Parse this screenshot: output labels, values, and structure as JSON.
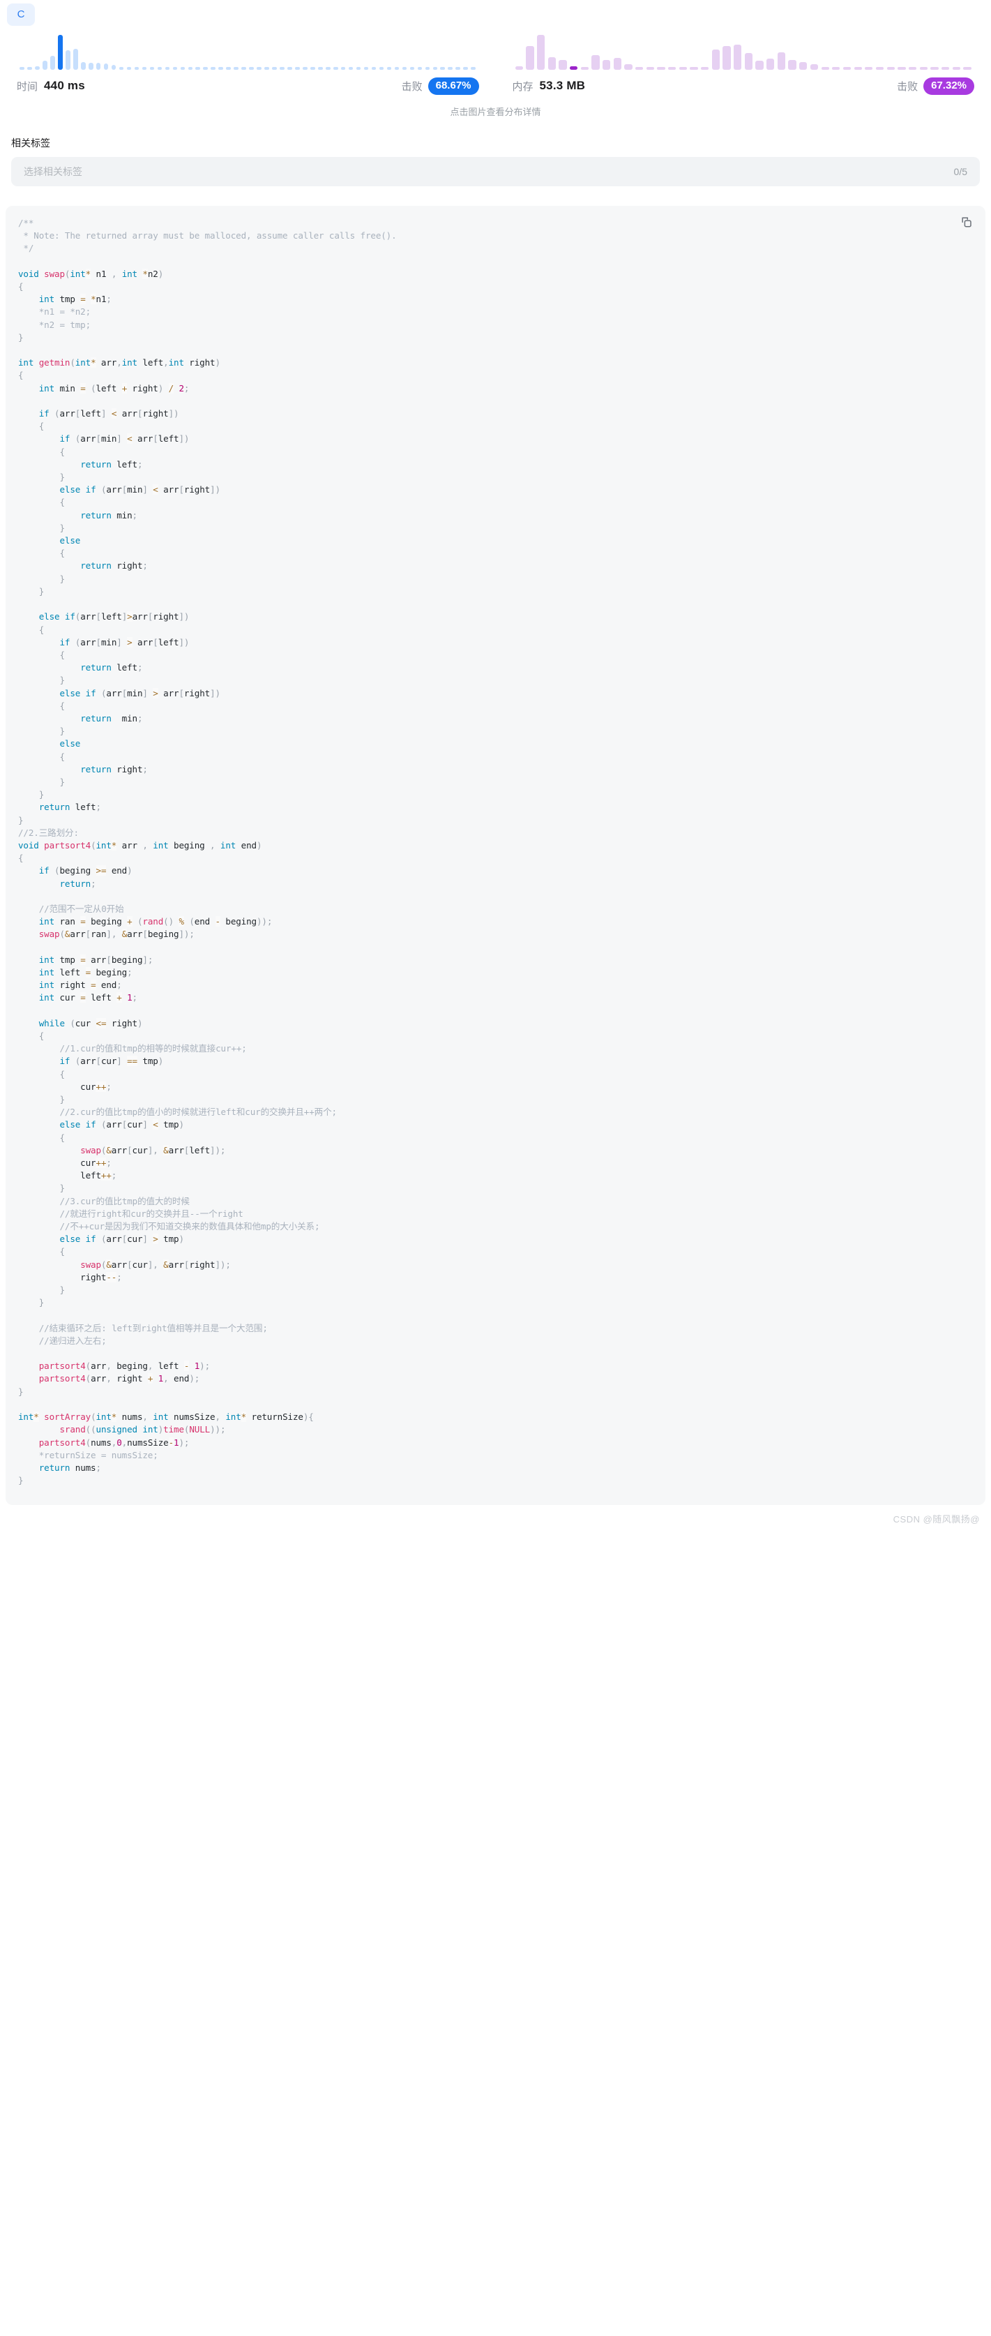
{
  "language_badge": "C",
  "stats": {
    "time": {
      "label": "时间",
      "value": "440 ms",
      "beat_label": "击败",
      "beat_value": "68.67%",
      "color": "#1575f0"
    },
    "memory": {
      "label": "内存",
      "value": "53.3 MB",
      "beat_label": "击败",
      "beat_value": "67.32%",
      "color": "#a83ae0"
    },
    "hint": "点击图片查看分布详情"
  },
  "chart_data": [
    {
      "type": "bar",
      "title": "时间分布",
      "xlabel": "",
      "ylabel": "",
      "highlight_index": 5,
      "highlight_color": "#1575f0",
      "bar_color": "#c7dffd",
      "values": [
        2,
        2,
        5,
        12,
        18,
        46,
        26,
        28,
        10,
        9,
        9,
        8,
        6,
        3,
        2,
        2,
        2,
        2,
        2,
        2,
        2,
        2,
        2,
        2,
        2,
        2,
        2,
        2,
        2,
        2,
        2,
        2,
        2,
        2,
        2,
        2,
        2,
        2,
        2,
        2,
        2,
        2,
        2,
        2,
        2,
        2,
        2,
        2,
        2,
        2,
        2,
        2,
        2,
        2,
        2,
        2,
        2,
        2,
        2,
        2
      ]
    },
    {
      "type": "bar",
      "title": "内存分布",
      "xlabel": "",
      "ylabel": "",
      "highlight_index": 5,
      "highlight_color": "#9b24c9",
      "bar_color": "#e6d0f2",
      "values": [
        4,
        26,
        38,
        14,
        11,
        4,
        2,
        16,
        11,
        13,
        6,
        3,
        2,
        2,
        2,
        2,
        2,
        2,
        22,
        26,
        27,
        18,
        10,
        12,
        19,
        11,
        8,
        6,
        3,
        2,
        2,
        2,
        2,
        2,
        2,
        2,
        2,
        2,
        2,
        2,
        2,
        2
      ]
    }
  ],
  "tags": {
    "title": "相关标签",
    "placeholder": "选择相关标签",
    "count": "0/5"
  },
  "code": {
    "copy_icon": "copy-icon",
    "language": "C",
    "lines": "/**\n * Note: The returned array must be malloced, assume caller calls free().\n */\n\nvoid swap(int* n1 , int *n2)\n{\n    int tmp = *n1;\n    *n1 = *n2;\n    *n2 = tmp;\n}\n\nint getmin(int* arr,int left,int right)\n{\n    int min = (left + right) / 2;\n\n    if (arr[left] < arr[right])\n    {\n        if (arr[min] < arr[left])\n        {\n            return left;\n        }\n        else if (arr[min] < arr[right])\n        {\n            return min;\n        }\n        else\n        {\n            return right;\n        }\n    }\n\n    else if(arr[left]>arr[right])\n    {\n        if (arr[min] > arr[left])\n        {\n            return left;\n        }\n        else if (arr[min] > arr[right])\n        {\n            return  min;\n        }\n        else\n        {\n            return right;\n        }\n    }\n    return left;\n}\n//2.三路划分:\nvoid partsort4(int* arr , int beging , int end)\n{\n    if (beging >= end)\n        return;\n\n    //范围不一定从0开始\n    int ran = beging + (rand() % (end - beging));\n    swap(&arr[ran], &arr[beging]);\n\n    int tmp = arr[beging];\n    int left = beging;\n    int right = end;\n    int cur = left + 1;\n\n    while (cur <= right)\n    {\n        //1.cur的值和tmp的相等的时候就直接cur++;\n        if (arr[cur] == tmp)\n        {\n            cur++;\n        }\n        //2.cur的值比tmp的值小的时候就进行left和cur的交换并且++两个;\n        else if (arr[cur] < tmp)\n        {\n            swap(&arr[cur], &arr[left]);\n            cur++;\n            left++;\n        }\n        //3.cur的值比tmp的值大的时候\n        //就进行right和cur的交换并且--一个right\n        //不++cur是因为我们不知道交换来的数值具体和他mp的大小关系;\n        else if (arr[cur] > tmp)\n        {\n            swap(&arr[cur], &arr[right]);\n            right--;\n        }\n    }\n\n    //结束循环之后: left到right值相等并且是一个大范围;\n    //递归进入左右;\n\n    partsort4(arr, beging, left - 1);\n    partsort4(arr, right + 1, end);\n}\n\nint* sortArray(int* nums, int numsSize, int* returnSize){\n        srand((unsigned int)time(NULL));\n    partsort4(nums,0,numsSize-1);\n    *returnSize = numsSize;\n    return nums;\n}"
  },
  "watermark": "CSDN @随风飘扬@"
}
